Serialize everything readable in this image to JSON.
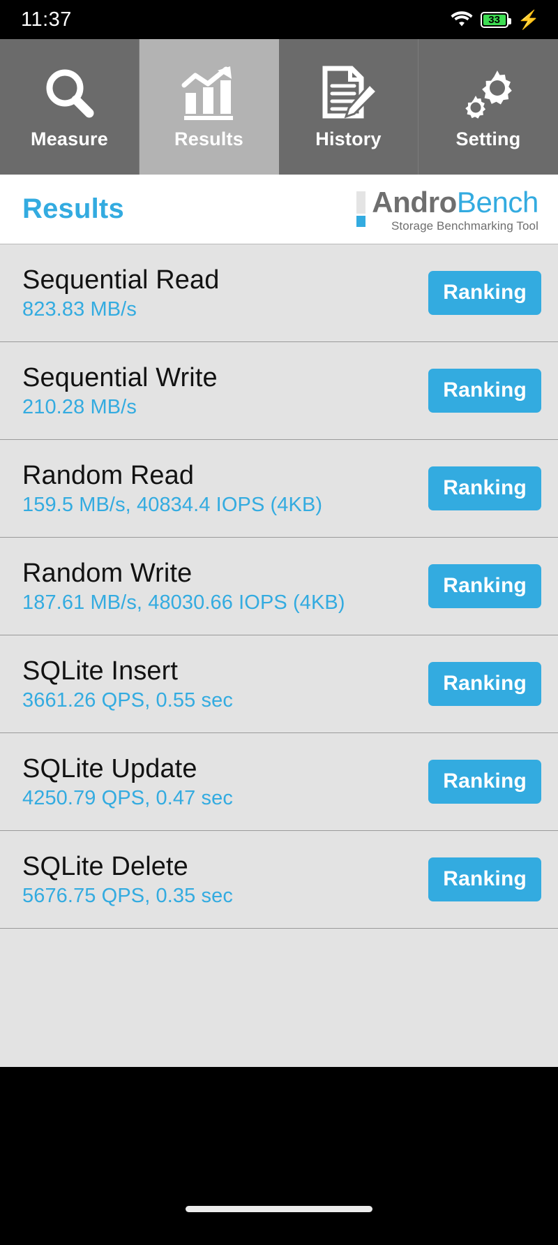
{
  "status_bar": {
    "time": "11:37",
    "wifi_icon": "wifi-icon",
    "battery_level": "33",
    "battery_color": "#3ddc52",
    "charging_icon": "⚡"
  },
  "tabs": [
    {
      "label": "Measure",
      "icon": "magnifier-icon",
      "active": false
    },
    {
      "label": "Results",
      "icon": "bar-chart-arrow-icon",
      "active": true
    },
    {
      "label": "History",
      "icon": "document-pencil-icon",
      "active": false
    },
    {
      "label": "Setting",
      "icon": "gears-icon",
      "active": false
    }
  ],
  "header": {
    "title": "Results",
    "logo_primary": "Andro",
    "logo_secondary": "Bench",
    "logo_tagline": "Storage Benchmarking Tool"
  },
  "colors": {
    "accent_blue": "#33abe0",
    "tab_inactive": "#6b6b6b",
    "tab_active": "#b3b3b3",
    "row_bg": "#e3e3e3",
    "battery_green": "#3ddc52"
  },
  "results": [
    {
      "name": "Sequential Read",
      "value": "823.83 MB/s",
      "button": "Ranking"
    },
    {
      "name": "Sequential Write",
      "value": "210.28 MB/s",
      "button": "Ranking"
    },
    {
      "name": "Random Read",
      "value": "159.5 MB/s, 40834.4 IOPS (4KB)",
      "button": "Ranking"
    },
    {
      "name": "Random Write",
      "value": "187.61 MB/s, 48030.66 IOPS (4KB)",
      "button": "Ranking"
    },
    {
      "name": "SQLite Insert",
      "value": "3661.26 QPS, 0.55 sec",
      "button": "Ranking"
    },
    {
      "name": "SQLite Update",
      "value": "4250.79 QPS, 0.47 sec",
      "button": "Ranking"
    },
    {
      "name": "SQLite Delete",
      "value": "5676.75 QPS, 0.35 sec",
      "button": "Ranking"
    }
  ]
}
